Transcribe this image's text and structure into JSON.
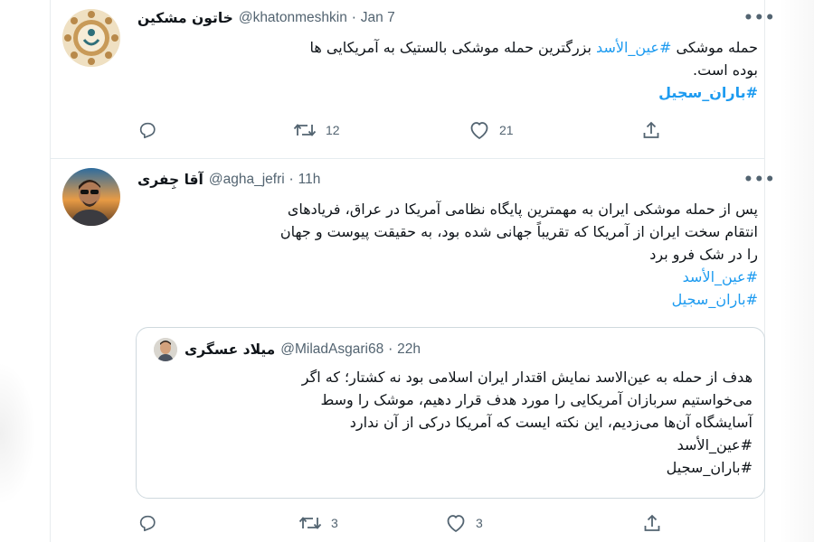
{
  "tweets": [
    {
      "name": "خاتون مشکین",
      "handle": "@khatonmeshkin",
      "time": "Jan 7",
      "text": {
        "line1_a": "حمله موشکی ",
        "line1_tag": "#عین_الأسد",
        "line1_b": " بزرگترین حمله موشکی بالستیک به آمریکایی ها",
        "line2": "بوده است.",
        "hashtag": "#باران_سجیل"
      },
      "replies": "",
      "retweets": "12",
      "likes": "21"
    },
    {
      "name": "آقا جِفری",
      "handle": "@agha_jefri",
      "time": "11h",
      "text": {
        "line1": "پس از حمله موشکی ایران به مهمترین پایگاه نظامی آمریکا در عراق، فریادهای",
        "line2": "انتقام سخت ایران از آمریکا که تقریباً جهانی شده بود، به حقیقت پیوست و جهان",
        "line3": "را در شک فرو برد",
        "hashtag1": "#عین_الأسد",
        "hashtag2": "#باران_سجیل"
      },
      "quote": {
        "name": "میلاد عسگری",
        "handle": "@MiladAsgari68",
        "time": "22h",
        "line1": "هدف از حمله به عین‌الاسد نمایش اقتدار ایران اسلامی بود نه کشتار؛ که اگر",
        "line2": "می‌خواستیم سربازان آمریکایی را مورد هدف قرار دهیم، موشک را وسط",
        "line3": "آسایشگاه آن‌ها می‌زدیم، این نکته ایست که آمریکا درکی از آن ندارد",
        "hashtag1": "#عین_الأسد",
        "hashtag2": "#باران_سجیل"
      },
      "replies": "",
      "retweets": "3",
      "likes": "3"
    }
  ],
  "more_glyph": "•••",
  "separator": "·",
  "icons": [
    "reply-icon",
    "retweet-icon",
    "like-icon",
    "share-icon",
    "more-icon"
  ],
  "colors": {
    "link": "#1d9bf0",
    "muted": "#536471",
    "text": "#0f1419",
    "border": "#cfd9de"
  }
}
